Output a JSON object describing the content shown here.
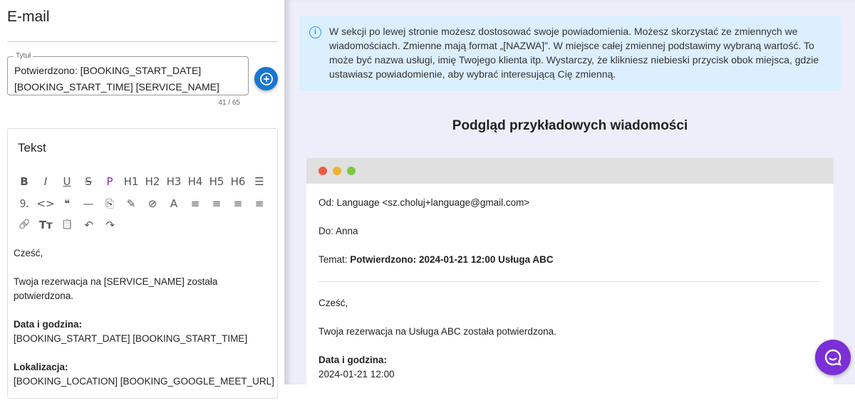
{
  "left": {
    "title": "E-mail",
    "field_label": "Tytuł",
    "field_value": "Potwierdzono: [BOOKING_START_DATE] [BOOKING_START_TIME] [SERVICE_NAME]",
    "counter": "41 / 65",
    "card_title": "Tekst",
    "toolbar": {
      "row1": [
        "B",
        "I",
        "U",
        "S",
        "P",
        "H1",
        "H2",
        "H3",
        "H4",
        "H5",
        "H6",
        "☰"
      ],
      "row2": [
        "⒐",
        "<>",
        "❝",
        "—",
        "⎘",
        "✎",
        "⊘",
        "A",
        "≡",
        "≡",
        "≡",
        "≡"
      ],
      "row3": [
        "🔗",
        "Tт",
        "📋",
        "↶",
        "↷"
      ]
    },
    "content": {
      "greeting": "Cześć,",
      "line1": "Twoja rezerwacja na [SERVICE_NAME] została potwierdzona.",
      "date_label": "Data i godzina:",
      "date_value": "[BOOKING_START_DATE] [BOOKING_START_TIME]",
      "loc_label": "Lokalizacja:",
      "loc_value": "[BOOKING_LOCATION] [BOOKING_GOOGLE_MEET_URL]"
    }
  },
  "right": {
    "info": "W sekcji po lewej stronie możesz dostosować swoje powiadomienia. Możesz skorzystać ze zmiennych we wiadomościach. Zmienne mają format „[NAZWA]”. W miejsce całej zmiennej podstawimy wybraną wartość. To może być nazwa usługi, imię Twojego klienta itp. Wystarczy, że klikniesz niebieski przycisk obok miejsca, gdzie ustawiasz powiadomienie, aby wybrać interesującą Cię zmienną.",
    "heading": "Podgląd przykładowych wiadomości",
    "email": {
      "from": "Od: Language <sz.choluj+language@gmail.com>",
      "to": "Do: Anna",
      "subject_label": "Temat: ",
      "subject": "Potwierdzono: 2024-01-21 12:00 Usługa ABC",
      "greeting": "Cześć,",
      "line1": "Twoja rezerwacja na Usługa ABC została potwierdzona.",
      "date_label": "Data i godzina:",
      "date_value": "2024-01-21 12:00"
    }
  },
  "colors": {
    "accent": "#1976d2",
    "active_format": "#8e24aa",
    "chat": "#7b2fd6",
    "info_bg": "#dcefff"
  }
}
